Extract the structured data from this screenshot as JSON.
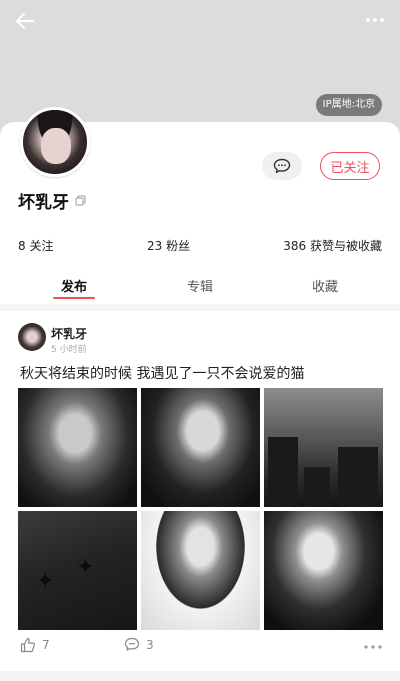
{
  "header": {
    "ip_location": "IP属地:北京"
  },
  "profile": {
    "username": "坏乳牙",
    "follow_label": "已关注"
  },
  "stats": {
    "following": "8 关注",
    "followers": "23 粉丝",
    "likes": "386 获赞与被收藏"
  },
  "tabs": [
    {
      "label": "发布",
      "active": true
    },
    {
      "label": "专辑",
      "active": false
    },
    {
      "label": "收藏",
      "active": false
    }
  ],
  "post": {
    "author": "坏乳牙",
    "time": "5 小时前",
    "text": "秋天将结束的时候 我遇见了一只不会说爱的猫",
    "like_count": "7",
    "comment_count": "3"
  },
  "icons": {
    "back": "arrow-left-icon",
    "more": "more-dots-icon",
    "message": "chat-bubble-icon",
    "copy": "copy-icon",
    "like": "thumbs-up-icon",
    "comment": "comment-icon"
  },
  "colors": {
    "accent": "#f0505a",
    "cover": "#dcdcdc",
    "page_bg": "#f4f4f4"
  }
}
